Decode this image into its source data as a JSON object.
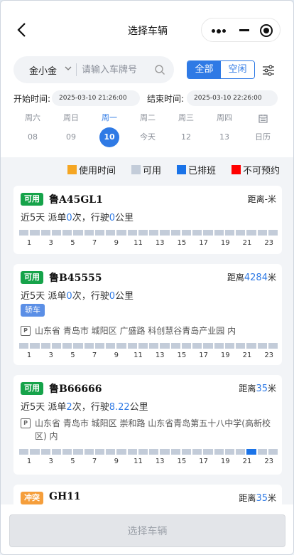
{
  "nav": {
    "title": "选择车辆"
  },
  "search": {
    "company": "金小金",
    "placeholder": "请输入车牌号"
  },
  "segment": {
    "all": "全部",
    "idle": "空闲"
  },
  "time": {
    "start_label": "开始时间:",
    "start_value": "2025-03-10 21:26:00",
    "end_label": "结束时间:",
    "end_value": "2025-03-10 22:26:00"
  },
  "week": [
    {
      "wk": "周六",
      "dt": "08"
    },
    {
      "wk": "周日",
      "dt": "09"
    },
    {
      "wk": "周一",
      "dt": "10",
      "selected": true
    },
    {
      "wk": "周二",
      "dt": "今天"
    },
    {
      "wk": "周三",
      "dt": "12"
    },
    {
      "wk": "周四",
      "dt": "13"
    },
    {
      "wk": "",
      "dt": "日历",
      "icon": "calendar-icon"
    }
  ],
  "legend": [
    {
      "label": "使用时间",
      "color": "#f5a623"
    },
    {
      "label": "可用",
      "color": "#c3ccd9"
    },
    {
      "label": "已排班",
      "color": "#1a73e8"
    },
    {
      "label": "不可预约",
      "color": "#ff0000"
    }
  ],
  "ticks": [
    "1",
    "3",
    "5",
    "7",
    "9",
    "11",
    "13",
    "15",
    "17",
    "19",
    "21",
    "23"
  ],
  "vehicles": [
    {
      "badge": "可用",
      "plate": "鲁A45GL1",
      "dist_prefix": "距离",
      "dist": "-",
      "dist_unit": "米",
      "stats_prefix": "近5天 派单",
      "orders": "0",
      "mid": "次，行驶",
      "km": "0",
      "unit": "公里",
      "type": "",
      "address": ""
    },
    {
      "badge": "可用",
      "plate": "鲁B45555",
      "dist_prefix": "距离",
      "dist": "4284",
      "dist_unit": "米",
      "stats_prefix": "近5天 派单",
      "orders": "0",
      "mid": "次，行驶",
      "km": "0",
      "unit": "公里",
      "type": "轿车",
      "address": "山东省 青岛市 城阳区 广盛路 科创慧谷青岛产业园 内"
    },
    {
      "badge": "可用",
      "plate": "鲁B66666",
      "dist_prefix": "距离",
      "dist": "35",
      "dist_unit": "米",
      "stats_prefix": "近5天 派单",
      "orders": "2",
      "mid": "次，行驶",
      "km": "8.22",
      "unit": "公里",
      "type": "",
      "address": "山东省 青岛市 城阳区 崇和路 山东省青岛第五十八中学(高新校区) 内"
    },
    {
      "badge": "冲突",
      "plate": "GH11",
      "dist_prefix": "距离",
      "dist": "35",
      "dist_unit": "米"
    }
  ],
  "submit": {
    "label": "选择车辆"
  },
  "colors": {
    "accent": "#2f7ae5",
    "available": "#16a34a",
    "conflict": "#f59e3b"
  }
}
